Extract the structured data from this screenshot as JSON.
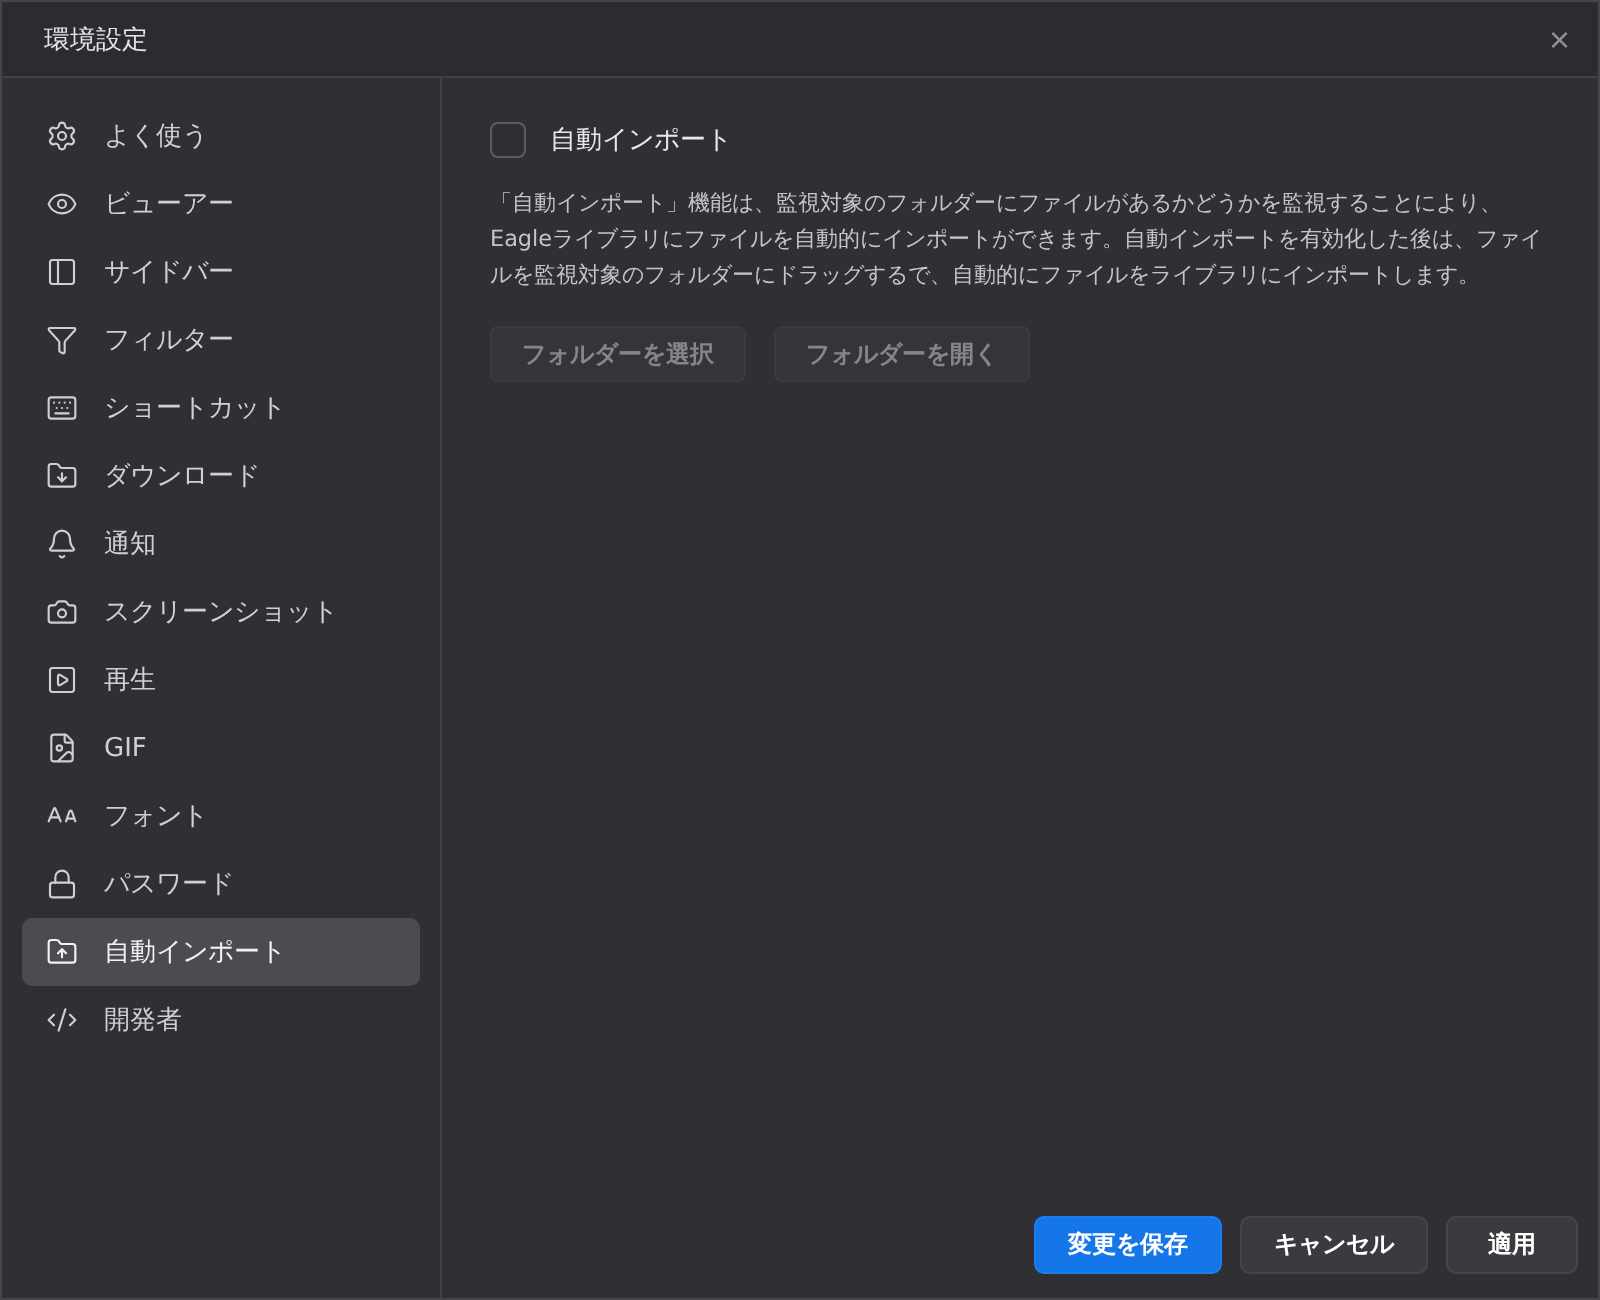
{
  "window": {
    "title": "環境設定",
    "close": "×"
  },
  "sidebar": {
    "items": [
      {
        "label": "よく使う",
        "selected": false
      },
      {
        "label": "ビューアー",
        "selected": false
      },
      {
        "label": "サイドバー",
        "selected": false
      },
      {
        "label": "フィルター",
        "selected": false
      },
      {
        "label": "ショートカット",
        "selected": false
      },
      {
        "label": "ダウンロード",
        "selected": false
      },
      {
        "label": "通知",
        "selected": false
      },
      {
        "label": "スクリーンショット",
        "selected": false
      },
      {
        "label": "再生",
        "selected": false
      },
      {
        "label": "GIF",
        "selected": false
      },
      {
        "label": "フォント",
        "selected": false
      },
      {
        "label": "パスワード",
        "selected": false
      },
      {
        "label": "自動インポート",
        "selected": true
      },
      {
        "label": "開発者",
        "selected": false
      }
    ]
  },
  "content": {
    "toggle": {
      "label": "自動インポート",
      "checked": false
    },
    "description": "「自動インポート」機能は、監視対象のフォルダーにファイルがあるかどうかを監視することにより、Eagleライブラリにファイルを自動的にインポートができます。自動インポートを有効化した後は、ファイルを監視対象のフォルダーにドラッグするで、自動的にファイルをライブラリにインポートします。",
    "buttons": [
      {
        "label": "フォルダーを選択",
        "disabled": true
      },
      {
        "label": "フォルダーを開く",
        "disabled": true
      }
    ]
  },
  "footer": {
    "buttons": [
      {
        "label": "変更を保存",
        "kind": "primary"
      },
      {
        "label": "キャンセル",
        "kind": "secondary"
      },
      {
        "label": "適用",
        "kind": "secondary"
      }
    ]
  }
}
